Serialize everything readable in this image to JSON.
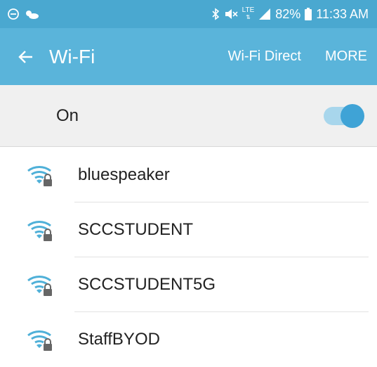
{
  "status_bar": {
    "battery_percent": "82%",
    "time": "11:33 AM",
    "network_type": "LTE",
    "icons": [
      "minus-circle-icon",
      "weather-icon",
      "bluetooth-icon",
      "mute-icon",
      "lte-icon",
      "signal-icon",
      "battery-icon"
    ]
  },
  "app_bar": {
    "title": "Wi-Fi",
    "direct_label": "Wi-Fi Direct",
    "more_label": "MORE"
  },
  "wifi_toggle": {
    "label": "On",
    "enabled": true
  },
  "networks": [
    {
      "name": "bluespeaker",
      "secured": true
    },
    {
      "name": "SCCSTUDENT",
      "secured": true
    },
    {
      "name": "SCCSTUDENT5G",
      "secured": true
    },
    {
      "name": "StaffBYOD",
      "secured": true
    }
  ],
  "colors": {
    "status_bar": "#4aa8d0",
    "app_bar": "#5ab4da",
    "accent": "#3fa3d6",
    "toggle_row_bg": "#f0f0f0"
  }
}
